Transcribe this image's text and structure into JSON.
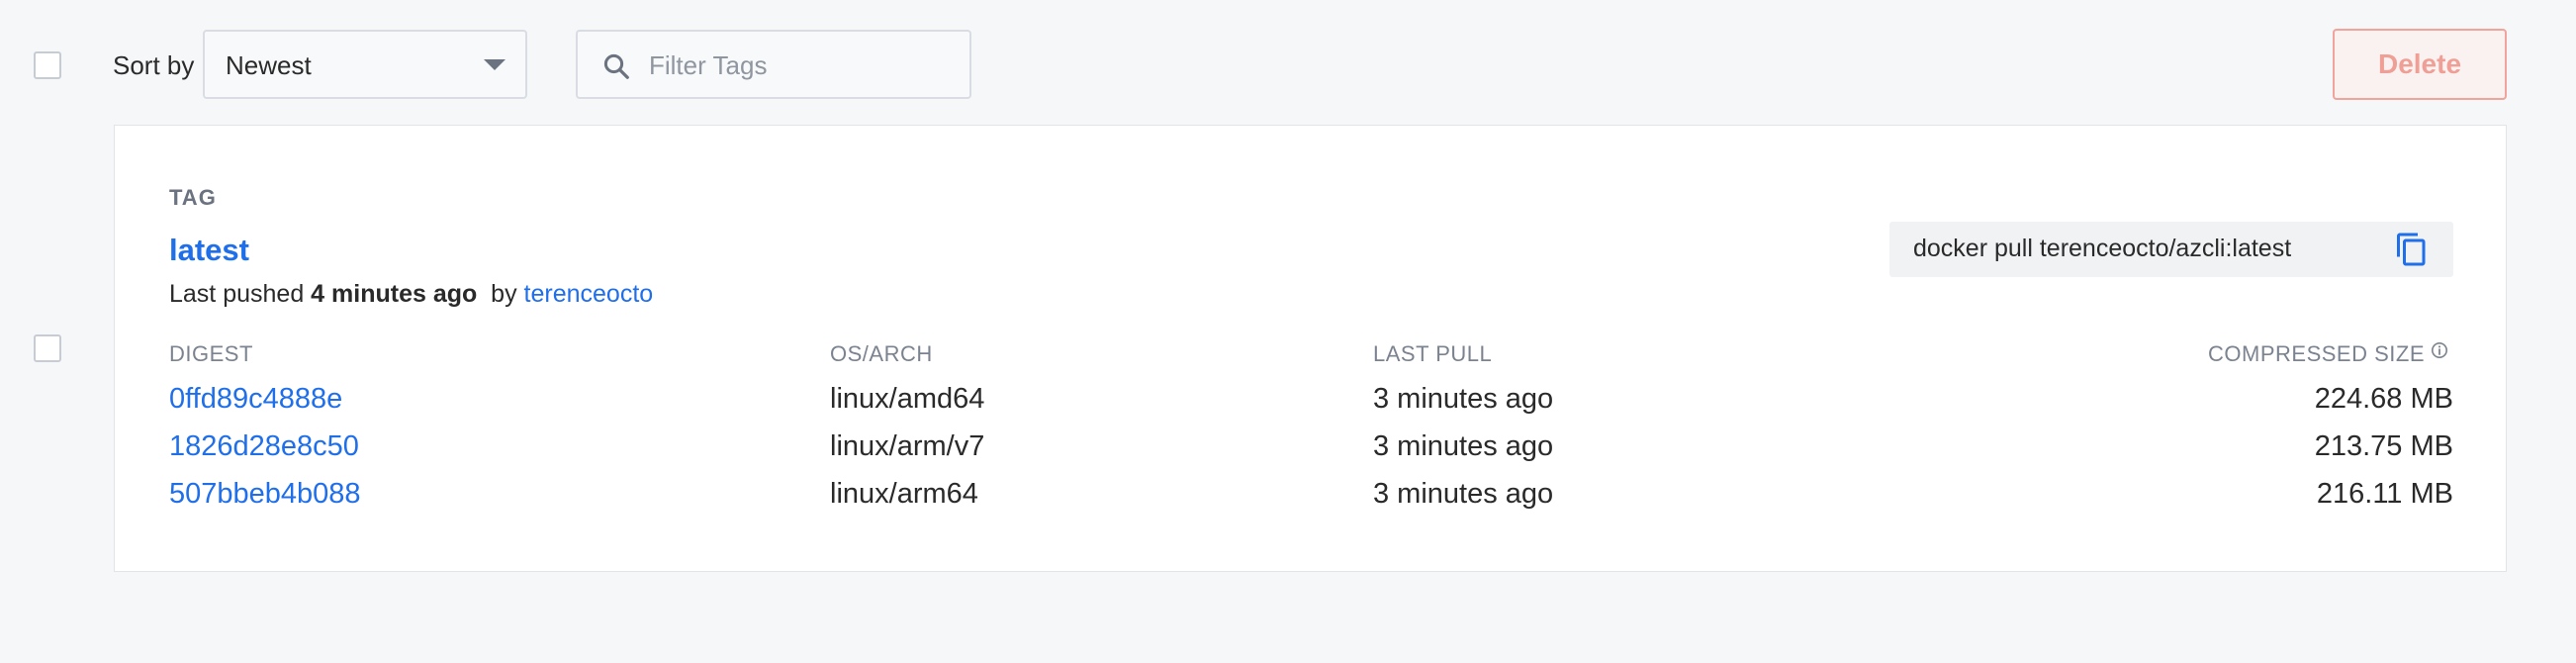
{
  "toolbar": {
    "sort_label": "Sort by",
    "sort_value": "Newest",
    "filter_placeholder": "Filter Tags",
    "delete_label": "Delete"
  },
  "tag": {
    "header_label": "TAG",
    "name": "latest",
    "push_prefix": "Last pushed",
    "push_time": "4 minutes ago",
    "push_by": "by",
    "pushed_by_user": "terenceocto",
    "pull_command": "docker pull terenceocto/azcli:latest"
  },
  "columns": {
    "digest": "DIGEST",
    "os_arch": "OS/ARCH",
    "last_pull": "LAST PULL",
    "compressed_size": "COMPRESSED SIZE"
  },
  "digests": [
    {
      "digest": "0ffd89c4888e",
      "os_arch": "linux/amd64",
      "last_pull": "3 minutes ago",
      "size": "224.68 MB"
    },
    {
      "digest": "1826d28e8c50",
      "os_arch": "linux/arm/v7",
      "last_pull": "3 minutes ago",
      "size": "213.75 MB"
    },
    {
      "digest": "507bbeb4b088",
      "os_arch": "linux/arm64",
      "last_pull": "3 minutes ago",
      "size": "216.11 MB"
    }
  ],
  "colors": {
    "link": "#1f6feb",
    "delete_border": "#f0a49b",
    "delete_text": "#ef9f95",
    "background": "#f6f7f9"
  },
  "icons": {
    "search": "search-icon",
    "sort_caret": "chevron-down-icon",
    "copy": "copy-icon",
    "info": "info-icon"
  }
}
